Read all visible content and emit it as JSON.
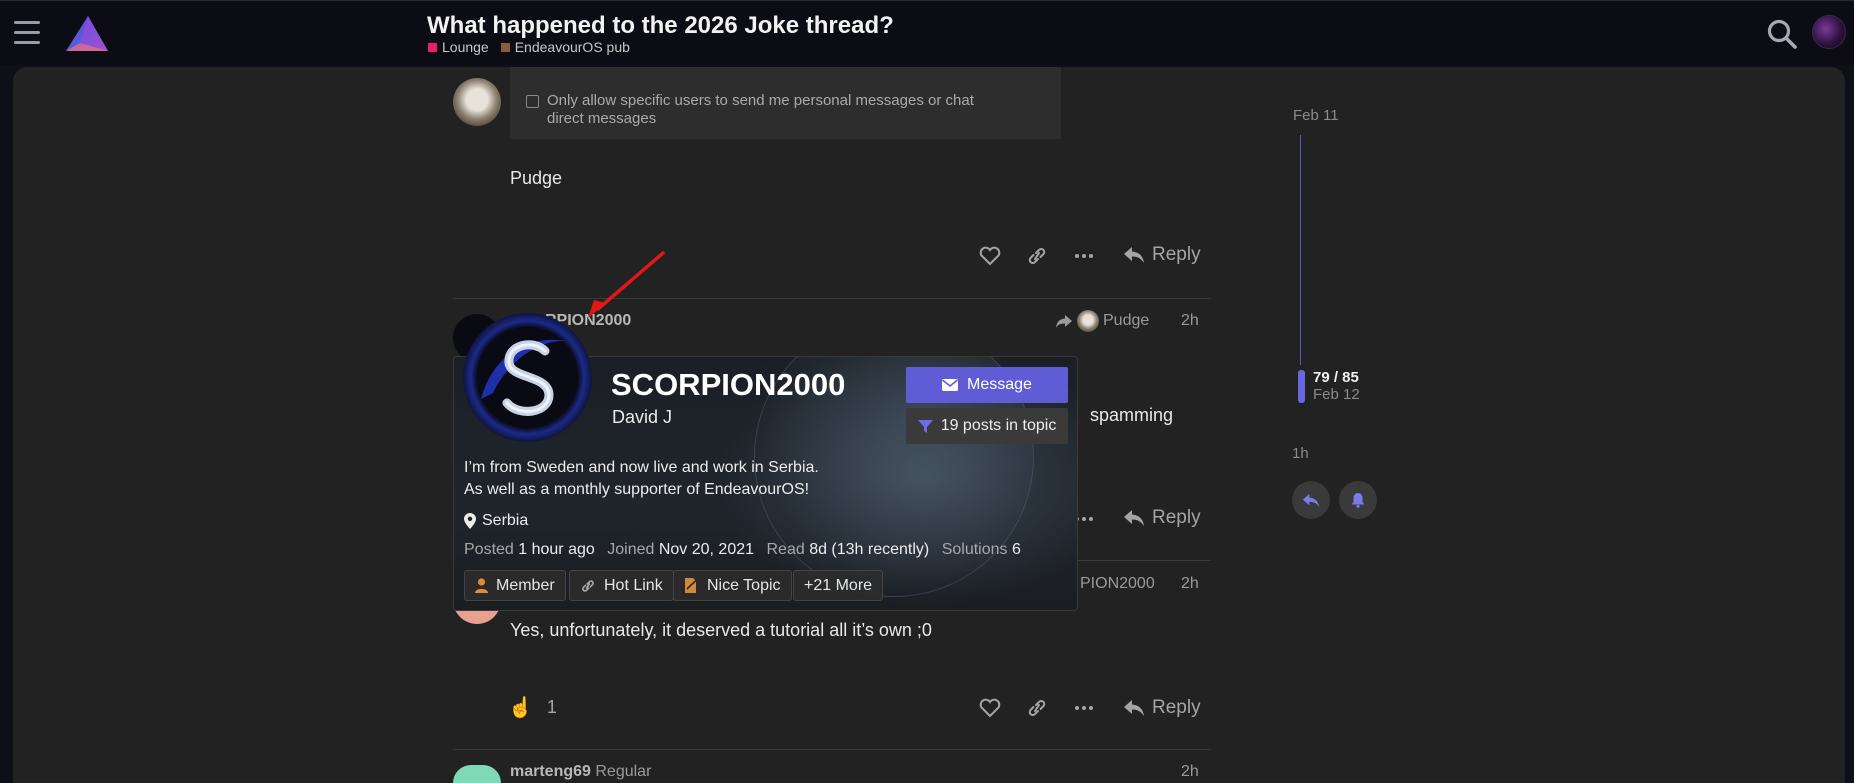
{
  "header": {
    "title": "What happened to the 2026 Joke thread?",
    "categories": [
      {
        "label": "Lounge",
        "color": "#e91e63"
      },
      {
        "label": "EndeavourOS pub",
        "color": "#8b5a3c"
      }
    ]
  },
  "posts": {
    "p1": {
      "pm_option": "Only allow specific users to send me personal messages or chat direct messages",
      "pm_line1": "Only allow specific users to send me personal messages or chat",
      "pm_line2": "direct messages",
      "signature": "Pudge",
      "reply_label": "Reply"
    },
    "p2": {
      "username": "SCORPION2000",
      "username_visible": "RPION2000",
      "reply_to": "Pudge",
      "age": "2h",
      "body_tail": "spamming",
      "reply_label": "Reply"
    },
    "p3": {
      "reply_to_visible": "PION2000",
      "age": "2h",
      "body": "Yes, unfortunately, it deserved a tutorial all it’s own ;0",
      "reactions": "1",
      "reply_label": "Reply"
    },
    "p4": {
      "username": "marteng69",
      "title": "Regular",
      "age": "2h"
    }
  },
  "timeline": {
    "start_date": "Feb 11",
    "position": "79 / 85",
    "current_date": "Feb 12",
    "end_label": "1h"
  },
  "user_card": {
    "username": "SCORPION2000",
    "real_name": "David J",
    "bio_line1": "I’m from Sweden and now live and work in Serbia.",
    "bio_line2": "As well as a monthly supporter of EndeavourOS!",
    "location": "Serbia",
    "posted_label": "Posted",
    "posted_value": "1 hour ago",
    "joined_label": "Joined",
    "joined_value": "Nov 20, 2021",
    "read_label": "Read",
    "read_value": "8d (13h recently)",
    "solutions_label": "Solutions",
    "solutions_value": "6",
    "message_button": "Message",
    "filter_button": "19 posts in topic",
    "badges": [
      "Member",
      "Hot Link",
      "Nice Topic",
      "+21 More"
    ]
  },
  "colors": {
    "accent": "#5f5cd6",
    "background": "#222222",
    "header": "#0c0c15",
    "annotation_arrow": "#e01818"
  }
}
